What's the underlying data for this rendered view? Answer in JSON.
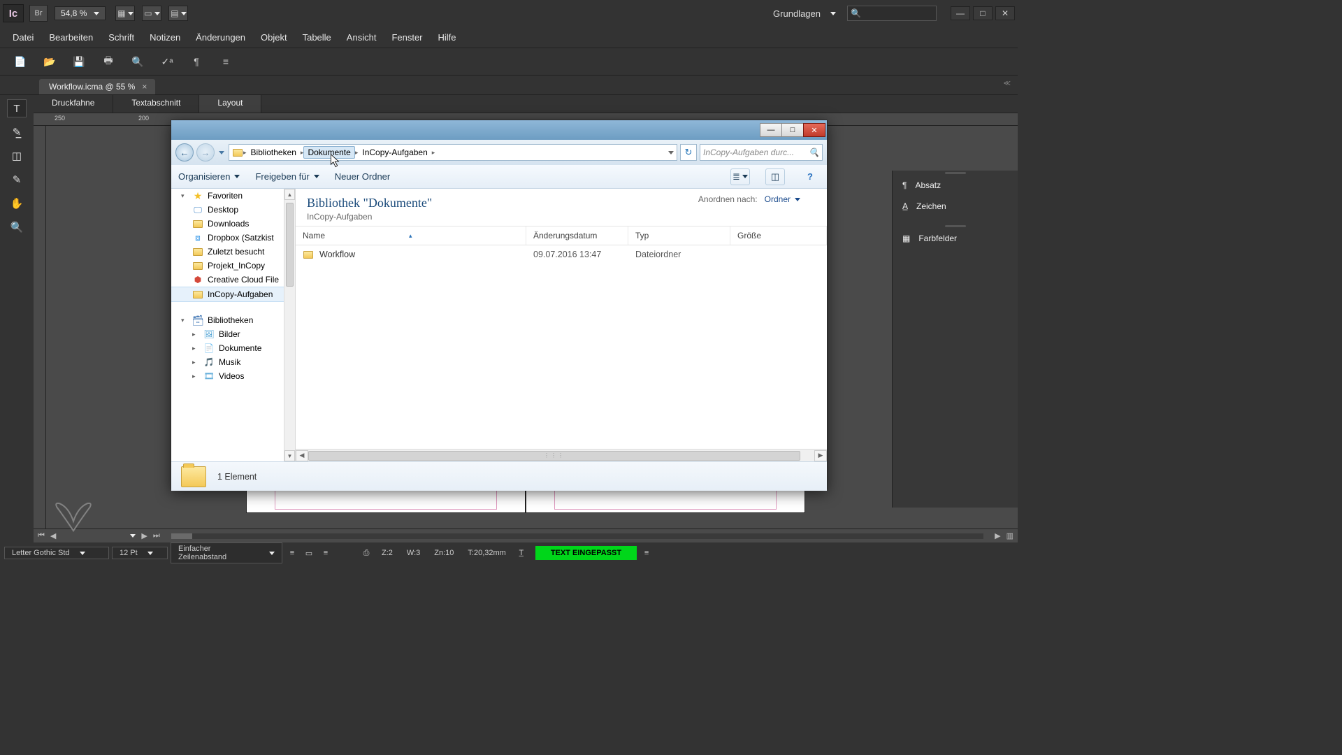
{
  "app": {
    "logo_text": "Ic",
    "bridge_badge": "Br",
    "zoom": "54,8 %"
  },
  "workspace": {
    "name": "Grundlagen"
  },
  "win_controls": {
    "min": "—",
    "max": "□",
    "close": "✕"
  },
  "menu": [
    "Datei",
    "Bearbeiten",
    "Schrift",
    "Notizen",
    "Änderungen",
    "Objekt",
    "Tabelle",
    "Ansicht",
    "Fenster",
    "Hilfe"
  ],
  "doc_tab": {
    "title": "Workflow.icma @ 55 %"
  },
  "view_tabs": [
    "Druckfahne",
    "Textabschnitt",
    "Layout"
  ],
  "ruler_marks": {
    "a": "250",
    "b": "200"
  },
  "panels": {
    "absatz": "Absatz",
    "zeichen": "Zeichen",
    "farbfelder": "Farbfelder"
  },
  "status": {
    "font": "Letter Gothic Std",
    "size": "12 Pt",
    "leading": "Einfacher Zeilenabstand",
    "z": "Z:2",
    "w": "W:3",
    "zn": "Zn:10",
    "t": "T:20,32mm",
    "fit": "TEXT EINGEPASST"
  },
  "explorer": {
    "breadcrumb": [
      "Bibliotheken",
      "Dokumente",
      "InCopy-Aufgaben"
    ],
    "search_placeholder": "InCopy-Aufgaben durc...",
    "toolbar": {
      "organize": "Organisieren",
      "share": "Freigeben für",
      "new_folder": "Neuer Ordner"
    },
    "lib_title": "Bibliothek \"Dokumente\"",
    "lib_sub": "InCopy-Aufgaben",
    "arrange_label": "Anordnen nach:",
    "arrange_value": "Ordner",
    "columns": {
      "name": "Name",
      "date": "Änderungsdatum",
      "type": "Typ",
      "size": "Größe"
    },
    "rows": [
      {
        "name": "Workflow",
        "date": "09.07.2016 13:47",
        "type": "Dateiordner",
        "size": ""
      }
    ],
    "status_text": "1 Element",
    "sidebar": {
      "favorites_label": "Favoriten",
      "favorites": [
        "Desktop",
        "Downloads",
        "Dropbox (Satzkist",
        "Zuletzt besucht",
        "Projekt_InCopy",
        "Creative Cloud File",
        "InCopy-Aufgaben"
      ],
      "libraries_label": "Bibliotheken",
      "libraries": [
        "Bilder",
        "Dokumente",
        "Musik",
        "Videos"
      ]
    }
  }
}
